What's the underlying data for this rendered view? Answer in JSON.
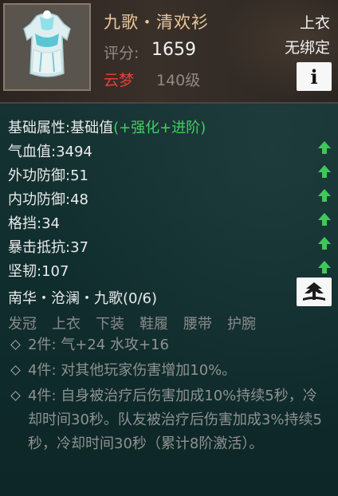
{
  "item": {
    "name": "九歌・清欢衫",
    "score_label": "评分:",
    "score_value": "1659",
    "school": "云梦",
    "level": "140级",
    "slot": "上衣",
    "bind_status": "无绑定",
    "info_button_label": "i"
  },
  "attributes": {
    "header_prefix": "基础属性:基础值",
    "header_suffix": "(+强化+进阶)",
    "rows": [
      {
        "label": "气血值:",
        "value": "3494"
      },
      {
        "label": "外功防御:",
        "value": "51"
      },
      {
        "label": "内功防御:",
        "value": "48"
      },
      {
        "label": "格挡:",
        "value": "34"
      },
      {
        "label": "暴击抵抗:",
        "value": "37"
      },
      {
        "label": "坚韧:",
        "value": "107"
      }
    ],
    "upgrade_icon": "green-up-arrow-icon"
  },
  "set": {
    "title": "南华・沧澜・九歌(0/6)",
    "pieces": [
      "发冠",
      "上衣",
      "下装",
      "鞋履",
      "腰带",
      "护腕"
    ],
    "bonuses": [
      "2件: 气+24 水攻+16",
      "4件: 对其他玩家伤害增加10%。",
      "4件: 自身被治疗后伤害加成10%持续5秒，冷却时间30秒。队友被治疗后伤害加成3%持续5秒，冷却时间30秒（累计8阶激活）。"
    ],
    "set_button_icon": "set-preview-icon"
  },
  "colors": {
    "name": "#e8c79a",
    "school": "#e0403a",
    "attribute_accent": "#40d060",
    "panel_bg": "#123030"
  }
}
